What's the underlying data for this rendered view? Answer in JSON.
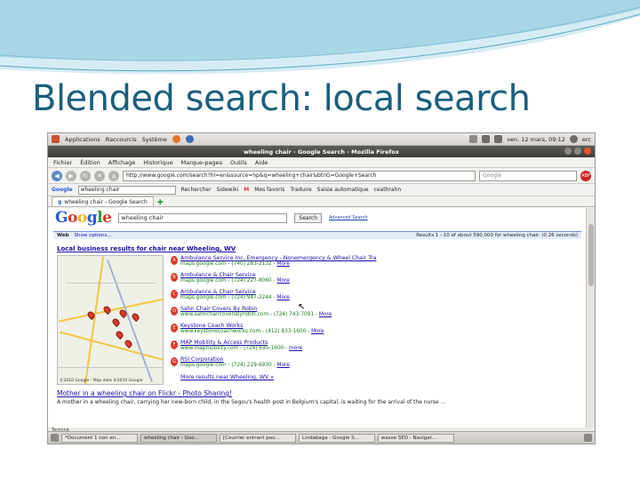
{
  "slide": {
    "title": "Blended search: local search"
  },
  "gnome_panel": {
    "items": [
      "Applications",
      "Raccourcis",
      "Système"
    ],
    "clock": "ven. 12 mars, 09:12",
    "user": "erc"
  },
  "window": {
    "title": "wheeling chair - Google Search - Mozilla Firefox"
  },
  "menu": {
    "items": [
      "Fichier",
      "Édition",
      "Affichage",
      "Historique",
      "Marque-pages",
      "Outils",
      "Aide"
    ]
  },
  "nav": {
    "url": "http://www.google.com/search?hl=en&source=hp&q=wheeling+chair&btnG=Google+Search",
    "search_placeholder": "Google"
  },
  "google_toolbar": {
    "query": "wheeling chair",
    "items": [
      "Rechercher",
      "Sidewiki",
      "Mes favoris",
      "Traduire",
      "Saisie automatique",
      "ceathrahn"
    ]
  },
  "tab": {
    "label": "wheeling chair - Google Search"
  },
  "google": {
    "logo": [
      "G",
      "o",
      "o",
      "g",
      "l",
      "e"
    ],
    "query": "wheeling chair",
    "search_button": "Search",
    "advanced_link": "Advanced Search",
    "results_bar_left": "Web",
    "results_bar_options": "Show options...",
    "results_bar_right": "Results 1 - 10 of about 590,000 for wheeling chair. (0.26 seconds)",
    "local_heading": "Local business results for chair near Wheeling, WV",
    "listings": [
      {
        "letter": "A",
        "title": "Ambulance Service Inc, Emergency - Nonemergency & Wheel Chair Tra",
        "url": "maps.google.com - (740) 283-2132 -",
        "more": "More"
      },
      {
        "letter": "B",
        "title": "Ambulance & Chair Service",
        "url": "maps.google.com - (724) 227-8060 -",
        "more": "More"
      },
      {
        "letter": "C",
        "title": "Ambulance & Chair Service",
        "url": "maps.google.com - (724) 947-2244 -",
        "more": "More"
      },
      {
        "letter": "D",
        "title": "Sahn Chair Covers By Robin",
        "url": "www.sahnchaircoversbyrobin.com - (724) 743-7091 -",
        "more": "More"
      },
      {
        "letter": "E",
        "title": "Keystone Coach Works",
        "url": "www.keystonecoachworks.com - (412) 833-1600 -",
        "more": "More"
      },
      {
        "letter": "F",
        "title": "MAP Mobility & Access Products",
        "url": "www.mapmobility.com - (724) 695-1600 -",
        "more": "more"
      },
      {
        "letter": "G",
        "title": "RSI Corporation",
        "url": "maps.google.com - (724) 229-6930 -",
        "more": "More"
      }
    ],
    "more_results": "More results near Wheeling, WV »",
    "map_copyright": "©2010 Google - Map data ©2010 Google",
    "result2_title": "Mother in a wheeling chair on Flickr - Photo Sharing!",
    "result2_snippet": "A mother in a wheeling chair, carrying her new-born child, in the Segou's health post in Belgium's capital, is waiting for the arrival of the nurse ..."
  },
  "status": {
    "text": "Terminé"
  },
  "taskbar": {
    "items": [
      "*Document 1 non en...",
      "wheeling chair - Goo...",
      "[Courrier entrant pou...",
      "Lindabaga - Google S...",
      "wasse SEO - Navigat..."
    ]
  },
  "colors": {
    "title": "#1b5f7c",
    "google_link": "#1a0dab",
    "url_green": "#1a7a1a",
    "marker_red": "#d93a2b"
  }
}
